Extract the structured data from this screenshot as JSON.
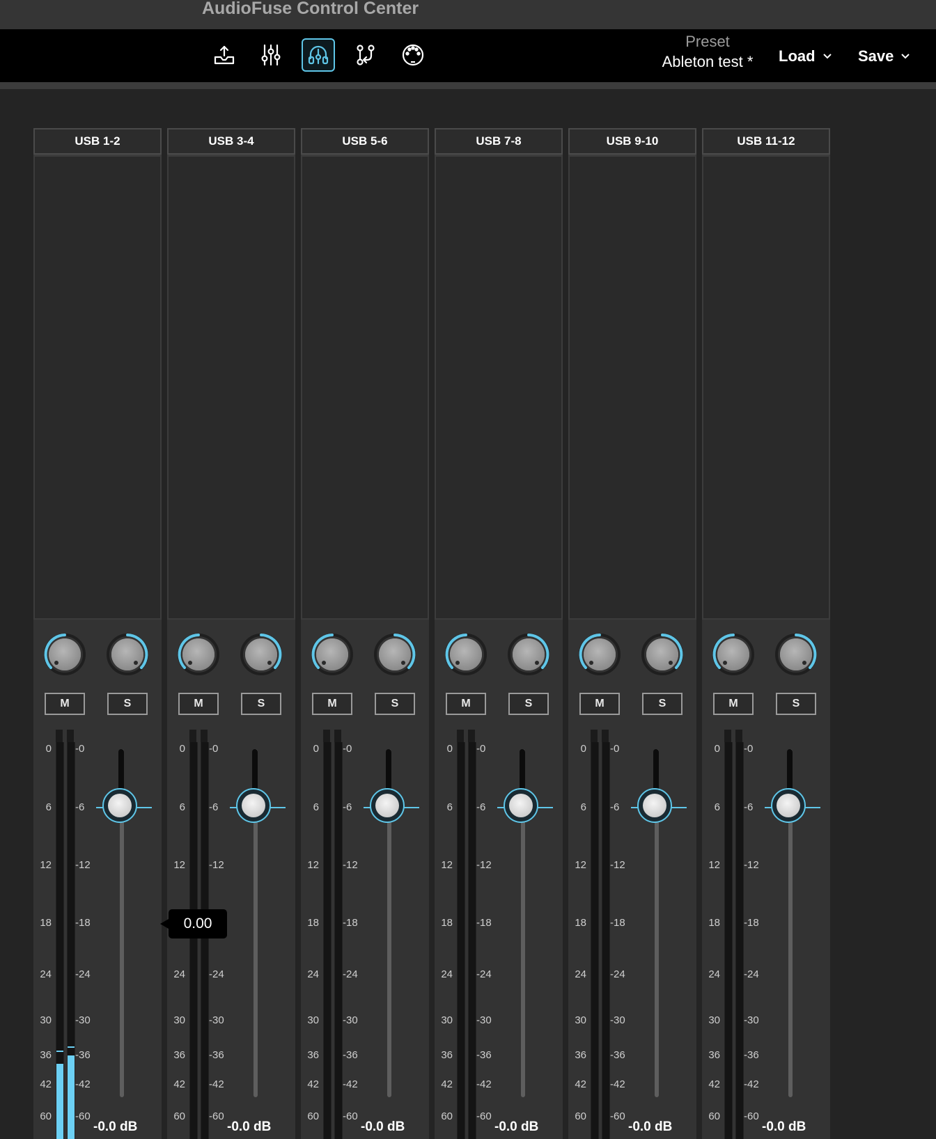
{
  "app": {
    "title": "AudioFuse Control Center"
  },
  "toolbar": {
    "buttons": [
      {
        "icon": "upload-tray-icon",
        "active": false
      },
      {
        "icon": "sliders-icon",
        "active": false
      },
      {
        "icon": "headphones-icon",
        "active": true
      },
      {
        "icon": "routing-icon",
        "active": false
      },
      {
        "icon": "midi-icon",
        "active": false
      }
    ],
    "preset_label": "Preset",
    "preset_name": "Ableton test *",
    "load_label": "Load",
    "save_label": "Save"
  },
  "colors": {
    "accent": "#5fc6e8",
    "meter": "#6cd0f4"
  },
  "scale": {
    "left": [
      "0",
      "6",
      "12",
      "18",
      "24",
      "30",
      "36",
      "42",
      "60"
    ],
    "right": [
      "-0",
      "-6",
      "-12",
      "-18",
      "-24",
      "-30",
      "-36",
      "-42",
      "-60"
    ]
  },
  "channels": [
    {
      "name": "USB 1-2",
      "mute_label": "M",
      "solo_label": "S",
      "db": "-0.0 dB",
      "meter_l": 0.19,
      "meter_r": 0.21,
      "peak_l": 0.22,
      "peak_r": 0.23
    },
    {
      "name": "USB 3-4",
      "mute_label": "M",
      "solo_label": "S",
      "db": "-0.0 dB",
      "meter_l": 0,
      "meter_r": 0,
      "peak_l": 0,
      "peak_r": 0
    },
    {
      "name": "USB 5-6",
      "mute_label": "M",
      "solo_label": "S",
      "db": "-0.0 dB",
      "meter_l": 0,
      "meter_r": 0,
      "peak_l": 0,
      "peak_r": 0
    },
    {
      "name": "USB 7-8",
      "mute_label": "M",
      "solo_label": "S",
      "db": "-0.0 dB",
      "meter_l": 0,
      "meter_r": 0,
      "peak_l": 0,
      "peak_r": 0
    },
    {
      "name": "USB 9-10",
      "mute_label": "M",
      "solo_label": "S",
      "db": "-0.0 dB",
      "meter_l": 0,
      "meter_r": 0,
      "peak_l": 0,
      "peak_r": 0
    },
    {
      "name": "USB 11-12",
      "mute_label": "M",
      "solo_label": "S",
      "db": "-0.0 dB",
      "meter_l": 0,
      "meter_r": 0,
      "peak_l": 0,
      "peak_r": 0
    }
  ],
  "tooltip": {
    "value": "0.00"
  }
}
